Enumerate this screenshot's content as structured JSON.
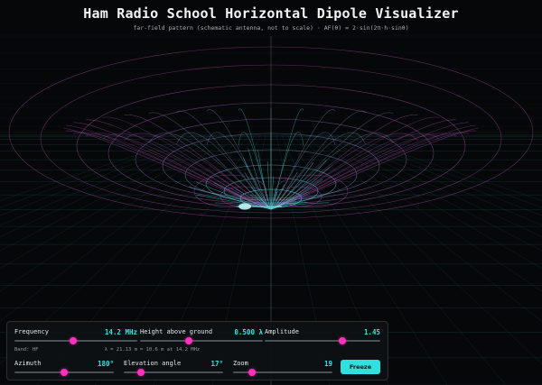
{
  "header": {
    "title": "Ham Radio School Horizontal Dipole Visualizer",
    "subtitle": "far-field pattern (schematic antenna, not to scale) · AF(θ) = 2·sin(2π·h·sinθ)"
  },
  "colors": {
    "background": "#050708",
    "accent_cyan": "#2fe0e0",
    "accent_magenta": "#ff2fbf",
    "value_text": "#38e3e3"
  },
  "controls": {
    "frequency": {
      "label": "Frequency",
      "value": "14.2 MHz",
      "level": 0.48,
      "note_left": "Band: HF",
      "note_right": "λ = 21.13 m"
    },
    "height": {
      "label": "Height above ground",
      "value": "0.500 λ",
      "level": 0.4,
      "note": "= 10.6 m at 14.2 MHz"
    },
    "amplitude": {
      "label": "Amplitude",
      "value": "1.45",
      "level": 0.67
    },
    "azimuth": {
      "label": "Azimuth",
      "value": "180°",
      "level": 0.5
    },
    "elevation": {
      "label": "Elevation angle",
      "value": "17°",
      "level": 0.17
    },
    "zoom": {
      "label": "Zoom",
      "value": "19",
      "level": 0.19
    },
    "freeze": {
      "label": "Freeze"
    }
  },
  "icons": {
    "slider_thumb": "circle-thumb-icon"
  }
}
